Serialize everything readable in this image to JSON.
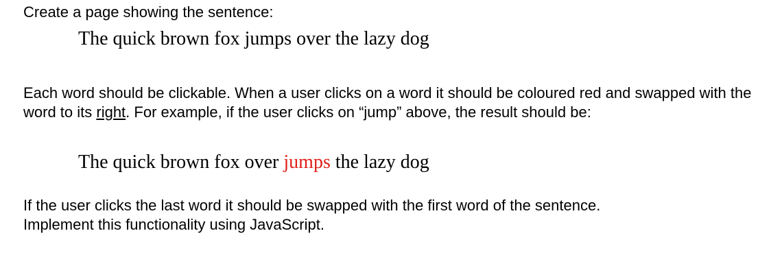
{
  "intro": "Create a page showing the sentence:",
  "sentence_original": [
    "The",
    "quick",
    "brown",
    "fox",
    "jumps",
    "over",
    "the",
    "lazy",
    "dog"
  ],
  "instructions": {
    "part1": "Each word should be clickable. When a user clicks on a word it should be coloured red and swapped with the word to its ",
    "underlined": "right",
    "part2": ". For example, if the user clicks on “jump” above, the result should be:"
  },
  "sentence_example": {
    "words": [
      "The",
      "quick",
      "brown",
      "fox",
      "over",
      "jumps",
      "the",
      "lazy",
      "dog"
    ],
    "highlight_index": 5,
    "highlight_color": "#e0201b"
  },
  "closing": {
    "line1": "If the user clicks the last word it should be swapped with the first word of the sentence.",
    "line2": "Implement this functionality using JavaScript."
  }
}
